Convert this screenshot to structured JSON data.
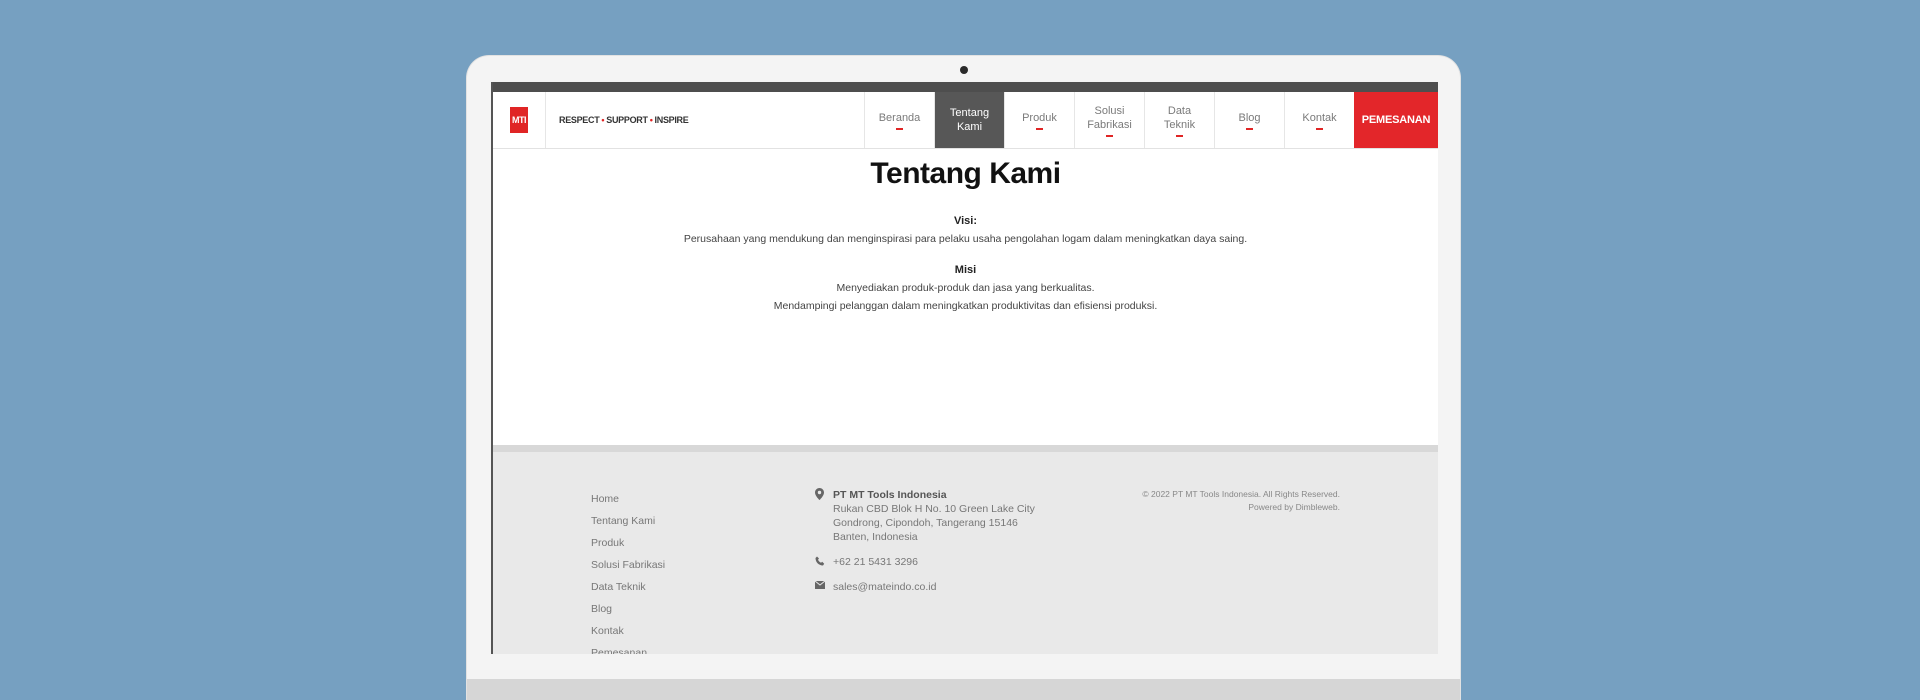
{
  "header": {
    "logo_text": "MTI",
    "tagline_parts": [
      "RESPECT",
      "SUPPORT",
      "INSPIRE"
    ]
  },
  "nav": {
    "items": [
      {
        "line1": "Beranda",
        "line2": ""
      },
      {
        "line1": "Tentang",
        "line2": "Kami",
        "active": true
      },
      {
        "line1": "Produk",
        "line2": ""
      },
      {
        "line1": "Solusi",
        "line2": "Fabrikasi"
      },
      {
        "line1": "Data",
        "line2": "Teknik"
      },
      {
        "line1": "Blog",
        "line2": ""
      },
      {
        "line1": "Kontak",
        "line2": ""
      }
    ],
    "order_label": "PEMESANAN"
  },
  "main": {
    "title": "Tentang Kami",
    "visi_label": "Visi:",
    "visi_text": "Perusahaan yang mendukung dan menginspirasi para pelaku usaha pengolahan logam dalam meningkatkan daya saing.",
    "misi_label": "Misi",
    "misi_lines": [
      "Menyediakan produk-produk dan jasa yang berkualitas.",
      "Mendampingi pelanggan dalam meningkatkan produktivitas dan efisiensi produksi."
    ]
  },
  "footer": {
    "links": [
      "Home",
      "Tentang Kami",
      "Produk",
      "Solusi Fabrikasi",
      "Data Teknik",
      "Blog",
      "Kontak",
      "Pemesanan"
    ],
    "company": "PT MT Tools Indonesia",
    "address_lines": [
      "Rukan CBD Blok H No. 10 Green Lake City",
      "Gondrong, Cipondoh, Tangerang 15146",
      "Banten, Indonesia"
    ],
    "phone": "+62 21 5431 3296",
    "email": "sales@mateindo.co.id",
    "copyright": "© 2022 PT MT Tools Indonesia. All Rights Reserved.",
    "powered_by": "Powered by Dimbleweb."
  },
  "colors": {
    "accent": "#e3262a",
    "active_nav": "#575757",
    "background": "#76a0c1"
  }
}
